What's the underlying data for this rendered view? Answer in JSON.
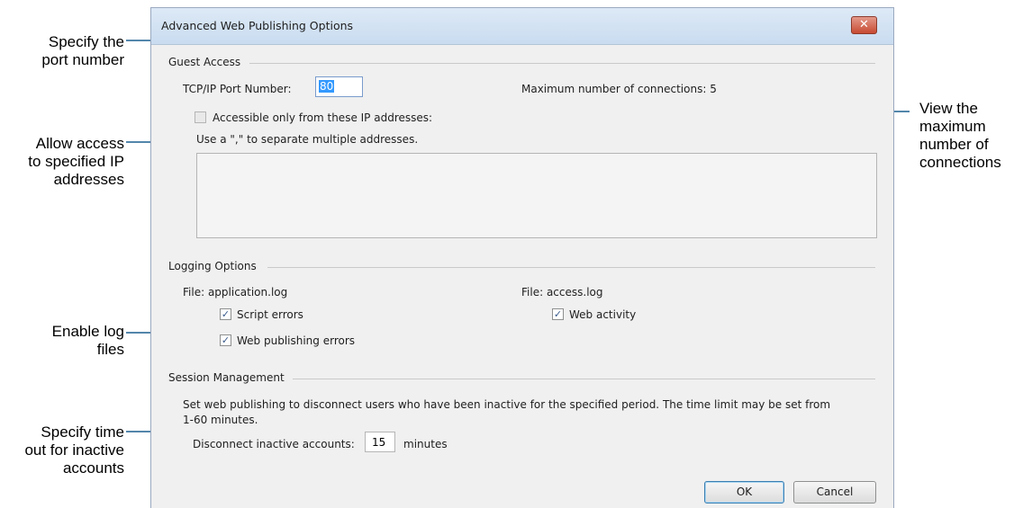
{
  "dialog": {
    "title": "Advanced Web Publishing Options",
    "close_label": "✕",
    "guest_access": {
      "label": "Guest Access",
      "port_label": "TCP/IP Port Number:",
      "port_value": "80",
      "max_connections_label": "Maximum number of connections: 5",
      "ip_restrict_label": "Accessible only from these IP addresses:",
      "ip_restrict_checked": false,
      "ip_hint": "Use a \",\" to separate multiple addresses.",
      "ip_addresses": ""
    },
    "logging": {
      "label": "Logging Options",
      "app_file": "File: application.log",
      "access_file": "File: access.log",
      "script_errors": "Script errors",
      "web_publishing_errors": "Web publishing errors",
      "web_activity": "Web activity"
    },
    "session": {
      "label": "Session Management",
      "description_line1": "Set web publishing to disconnect users who have been inactive for the specified period.  The time limit may be set from",
      "description_line2": "1-60 minutes.",
      "disconnect_label": "Disconnect inactive accounts:",
      "disconnect_value": "15",
      "minutes_label": "minutes"
    },
    "ok_label": "OK",
    "cancel_label": "Cancel"
  },
  "callouts": {
    "port": [
      "Specify the",
      "port number"
    ],
    "ip": [
      "Allow access",
      "to specified IP",
      "addresses"
    ],
    "logs": [
      "Enable log",
      "files"
    ],
    "timeout": [
      "Specify time",
      "out for inactive",
      "accounts"
    ],
    "max": [
      "View the",
      "maximum",
      "number of",
      "connections"
    ]
  },
  "colors": {
    "leader": "#1a5e8f",
    "title_bar": "#dde9f6",
    "close": "#c74a32"
  }
}
